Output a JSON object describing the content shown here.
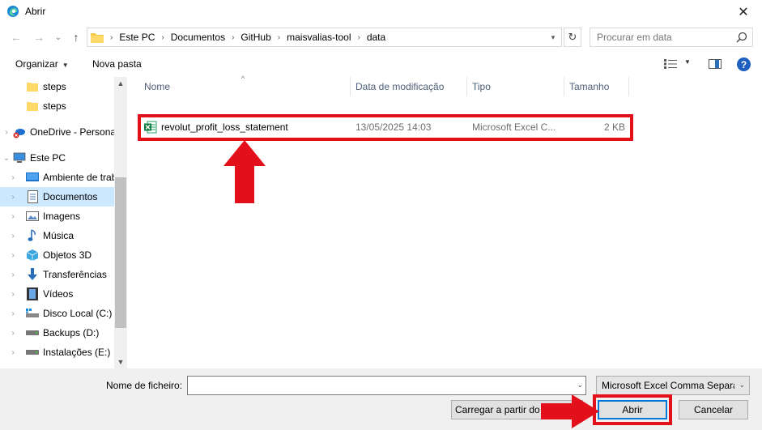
{
  "window": {
    "title": "Abrir",
    "close_glyph": "✕"
  },
  "nav": {
    "back": "←",
    "forward": "→",
    "recent": "⌄",
    "up": "↑"
  },
  "address": {
    "crumbs": [
      "Este PC",
      "Documentos",
      "GitHub",
      "maisvalias-tool",
      "data"
    ],
    "separator": "›"
  },
  "search": {
    "placeholder": "Procurar em data"
  },
  "toolbar": {
    "organize_label": "Organizar",
    "new_folder_label": "Nova pasta",
    "help_label": "?"
  },
  "sidebar": {
    "items": [
      {
        "label": "steps",
        "icon": "folder-icon"
      },
      {
        "label": "steps",
        "icon": "folder-icon"
      },
      {
        "label": "OneDrive - Personal",
        "icon": "onedrive-icon"
      },
      {
        "label": "Este PC",
        "icon": "computer-icon"
      },
      {
        "label": "Ambiente de trabalho",
        "icon": "desktop-icon"
      },
      {
        "label": "Documentos",
        "icon": "documents-icon"
      },
      {
        "label": "Imagens",
        "icon": "pictures-icon"
      },
      {
        "label": "Música",
        "icon": "music-icon"
      },
      {
        "label": "Objetos 3D",
        "icon": "objects3d-icon"
      },
      {
        "label": "Transferências",
        "icon": "downloads-icon"
      },
      {
        "label": "Vídeos",
        "icon": "videos-icon"
      },
      {
        "label": "Disco Local (C:)",
        "icon": "drive-icon"
      },
      {
        "label": "Backups (D:)",
        "icon": "drive-icon"
      },
      {
        "label": "Instalações (E:)",
        "icon": "drive-icon"
      }
    ],
    "selected": "Documentos"
  },
  "columns": {
    "name": "Nome",
    "modified": "Data de modificação",
    "type": "Tipo",
    "size": "Tamanho"
  },
  "files": [
    {
      "name": "revolut_profit_loss_statement",
      "modified": "13/05/2025 14:03",
      "type": "Microsoft Excel C...",
      "size": "2 KB",
      "icon": "excel-csv-icon"
    }
  ],
  "footer": {
    "filename_label": "Nome de ficheiro:",
    "filename_value": "",
    "filetype_value": "Microsoft Excel Comma Separated",
    "load_label": "Carregar a partir do telemóvel",
    "open_label": "Abrir",
    "cancel_label": "Cancelar"
  },
  "colors": {
    "highlight": "#e3101c",
    "selection": "#cce8ff",
    "accent": "#0078d7"
  }
}
